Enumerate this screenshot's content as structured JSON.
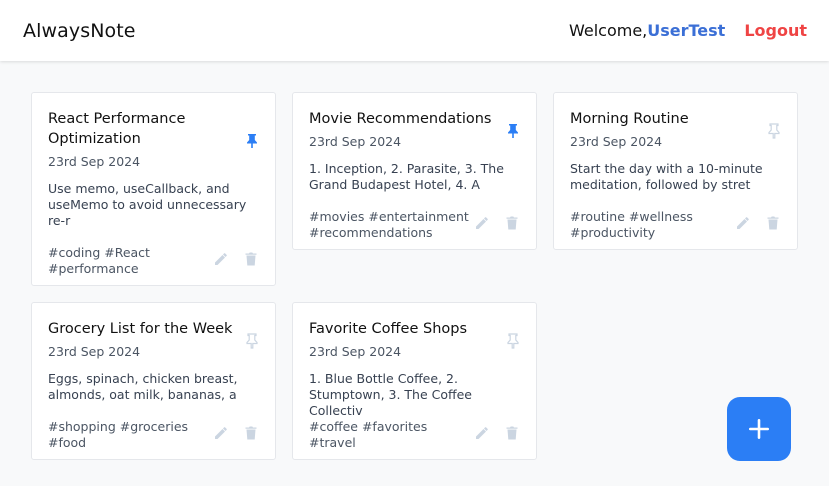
{
  "app": {
    "brand": "AlwaysNote",
    "welcome": "Welcome,",
    "username": "UserTest",
    "logout": "Logout"
  },
  "colors": {
    "accent": "#2b7ef5",
    "username": "#3b6fd6",
    "logout": "#ef4444",
    "pinned": "#2b7ef5",
    "unpinned": "#cbd5e1",
    "action_icon": "#cbd5e1"
  },
  "notes": [
    {
      "title": "React Performance Optimization",
      "date": "23rd Sep 2024",
      "content": "Use memo, useCallback, and useMemo to avoid unnecessary re-r",
      "tags": "#coding #React #performance",
      "pinned": true
    },
    {
      "title": "Movie Recommendations",
      "date": "23rd Sep 2024",
      "content": "1. Inception, 2. Parasite, 3. The Grand Budapest Hotel, 4. A",
      "tags": "#movies #entertainment #recommendations",
      "pinned": true
    },
    {
      "title": "Morning Routine",
      "date": "23rd Sep 2024",
      "content": "Start the day with a 10-minute meditation, followed by stret",
      "tags": "#routine #wellness #productivity",
      "pinned": false
    },
    {
      "title": "Grocery List for the Week",
      "date": "23rd Sep 2024",
      "content": "Eggs, spinach, chicken breast, almonds, oat milk, bananas, a",
      "tags": "#shopping #groceries #food",
      "pinned": false
    },
    {
      "title": "Favorite Coffee Shops",
      "date": "23rd Sep 2024",
      "content": "1. Blue Bottle Coffee, 2. Stumptown, 3. The Coffee Collectiv",
      "tags": "#coffee #favorites #travel",
      "pinned": false
    }
  ],
  "icons": {
    "pin": "pin-icon",
    "edit": "pencil-icon",
    "delete": "trash-icon",
    "add": "plus-icon"
  }
}
